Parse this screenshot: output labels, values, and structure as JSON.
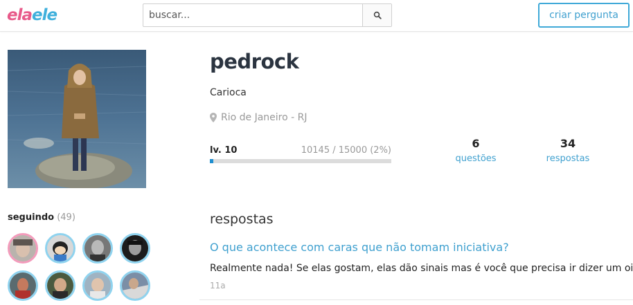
{
  "header": {
    "logo_part1": "ela",
    "logo_part2": "ele",
    "search_placeholder": "buscar...",
    "search_icon": "search-icon",
    "create_button": "criar pergunta"
  },
  "profile": {
    "username": "pedrock",
    "bio": "Carioca",
    "location": "Rio de Janeiro - RJ",
    "location_icon": "map-pin-icon",
    "level_label": "lv. 10",
    "xp_text": "10145 / 15000 (2%)",
    "xp_progress_percent": 2,
    "stats": [
      {
        "value": "6",
        "label": "questões"
      },
      {
        "value": "34",
        "label": "respostas"
      }
    ]
  },
  "following": {
    "label": "seguindo",
    "count": "(49)",
    "avatar_count": 8
  },
  "answers": {
    "title": "respostas",
    "items": [
      {
        "question": "O que acontece com caras que não tomam iniciativa?",
        "answer": "Realmente nada! Se elas gostam, elas dão sinais mas é você que precisa ir dizer um oi.",
        "time": "11a"
      }
    ]
  },
  "colors": {
    "brand_pink": "#e85a8a",
    "brand_blue": "#3fb0dc",
    "link_blue": "#3fa0cf",
    "progress_blue": "#1f8fd0"
  }
}
